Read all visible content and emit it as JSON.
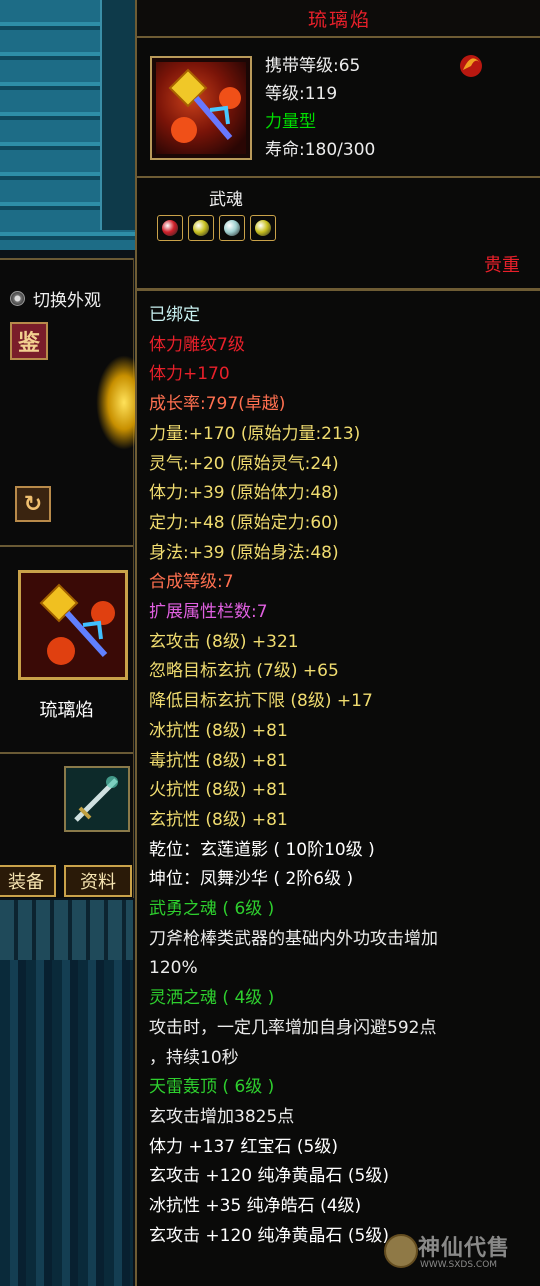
{
  "item": {
    "name": "琉璃焰",
    "carry_level": "携带等级:65",
    "level": "等级:119",
    "type": "力量型",
    "lifespan": "寿命:180/300",
    "soul_label": "武魂",
    "rarity": "贵重"
  },
  "left_panel": {
    "switch_appearance": "切换外观",
    "appraise_button": "鉴",
    "item_name": "琉璃焰",
    "tab_equip": "装备",
    "tab_info": "资料"
  },
  "colors": {
    "red": "#e8202a",
    "green": "#00dd00",
    "yellow": "#f0dc70",
    "cyan": "#c8f0f0",
    "white": "#ececec",
    "purple": "#e060e0",
    "orange": "#ff7050",
    "soul_green": "#2ecf2e"
  },
  "lines": [
    {
      "text": "已绑定",
      "color": "#c8f0f0"
    },
    {
      "text": "体力雕纹7级",
      "color": "#e8202a"
    },
    {
      "text": "体力+170",
      "color": "#e8202a"
    },
    {
      "text": "成长率:797(卓越)",
      "color": "#ff7050"
    },
    {
      "text": "力量:+170  (原始力量:213)",
      "color": "#f0dc70"
    },
    {
      "text": "灵气:+20  (原始灵气:24)",
      "color": "#f0dc70"
    },
    {
      "text": "体力:+39  (原始体力:48)",
      "color": "#f0dc70"
    },
    {
      "text": "定力:+48  (原始定力:60)",
      "color": "#f0dc70"
    },
    {
      "text": "身法:+39  (原始身法:48)",
      "color": "#f0dc70"
    },
    {
      "text": "合成等级:7",
      "color": "#ff7050"
    },
    {
      "text": "扩展属性栏数:7",
      "color": "#e060e0"
    },
    {
      "text": "玄攻击 (8级) +321",
      "color": "#f0dc70"
    },
    {
      "text": "忽略目标玄抗 (7级) +65",
      "color": "#f0dc70"
    },
    {
      "text": "降低目标玄抗下限 (8级) +17",
      "color": "#f0dc70"
    },
    {
      "text": "冰抗性 (8级) +81",
      "color": "#f0dc70"
    },
    {
      "text": "毒抗性 (8级) +81",
      "color": "#f0dc70"
    },
    {
      "text": "火抗性 (8级) +81",
      "color": "#f0dc70"
    },
    {
      "text": "玄抗性 (8级) +81",
      "color": "#f0dc70"
    },
    {
      "text": "乾位：玄莲道影 ( 10阶10级 )",
      "color": "#ffffff"
    },
    {
      "text": "坤位：凤舞沙华 ( 2阶6级 )",
      "color": "#ffffff"
    },
    {
      "text": "武勇之魂 ( 6级 )",
      "color": "#2ecf2e"
    },
    {
      "text": "刀斧枪棒类武器的基础内外功攻击增加",
      "color": "#ececec"
    },
    {
      "text": "120%",
      "color": "#ececec"
    },
    {
      "text": "灵洒之魂 ( 4级 )",
      "color": "#2ecf2e"
    },
    {
      "text": "攻击时，一定几率增加自身闪避592点",
      "color": "#ececec"
    },
    {
      "text": "，持续10秒",
      "color": "#ececec"
    },
    {
      "text": "天雷轰顶 ( 6级 )",
      "color": "#2ecf2e"
    },
    {
      "text": "玄攻击增加3825点",
      "color": "#ececec"
    },
    {
      "text": "体力 +137 红宝石 (5级)",
      "color": "#ffffff"
    },
    {
      "text": "玄攻击 +120 纯净黄晶石 (5级)",
      "color": "#ffffff"
    },
    {
      "text": "冰抗性 +35 纯净皓石 (4级)",
      "color": "#ffffff"
    },
    {
      "text": "玄攻击 +120 纯净黄晶石 (5级)",
      "color": "#ffffff"
    }
  ],
  "gems": [
    {
      "name": "ruby-gem-icon",
      "color": "#d0202a"
    },
    {
      "name": "yellow-crystal-gem-icon",
      "color": "#c8c020"
    },
    {
      "name": "white-gem-icon",
      "color": "#a0d0d0"
    },
    {
      "name": "yellow-crystal-gem-icon-2",
      "color": "#c8c020"
    }
  ],
  "watermark": {
    "logo_text": "神仙代售",
    "url": "WWW.SXDS.COM"
  }
}
